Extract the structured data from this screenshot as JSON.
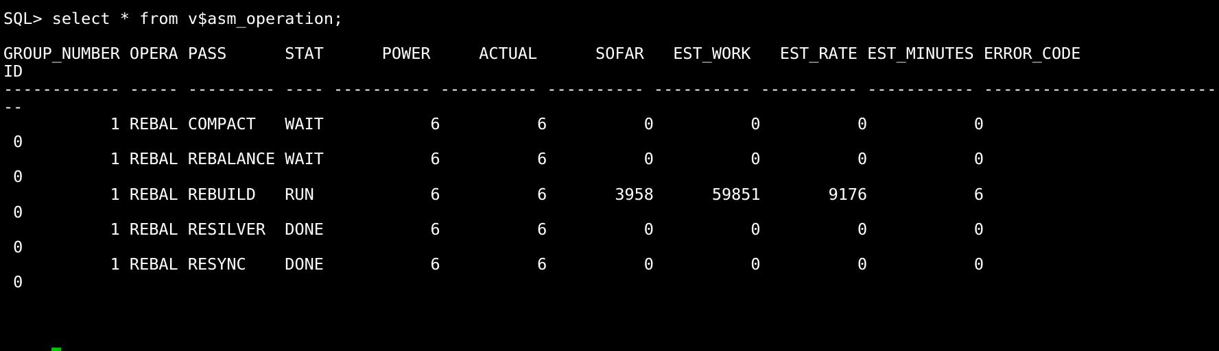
{
  "terminal": {
    "prompt_line": "SQL> select * from v$asm_operation;",
    "header_1": "GROUP_NUMBER OPERA PASS      STAT      POWER     ACTUAL      SOFAR   EST_WORK   EST_RATE EST_MINUTES ERROR_CODE",
    "header_2": "ID",
    "separator_1": "------------ ----- --------- ---- ---------- ---------- ---------- ---------- ---------- ----------- --------------------------",
    "separator_2": "--",
    "rows": [
      {
        "line": "           1 REBAL COMPACT   WAIT           6          6          0          0          0           0",
        "con_id": " 0"
      },
      {
        "line": "           1 REBAL REBALANCE WAIT           6          6          0          0          0           0",
        "con_id": " 0"
      },
      {
        "line": "           1 REBAL REBUILD   RUN            6          6       3958      59851       9176           6",
        "con_id": " 0"
      },
      {
        "line": "           1 REBAL RESILVER  DONE           6          6          0          0          0           0",
        "con_id": " 0"
      },
      {
        "line": "           1 REBAL RESYNC    DONE           6          6          0          0          0           0",
        "con_id": " 0"
      }
    ],
    "colors": {
      "background": "#000000",
      "text": "#ffffff",
      "cursor": "#00c000"
    }
  }
}
